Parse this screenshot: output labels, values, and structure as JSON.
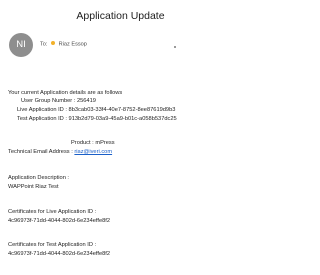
{
  "email": {
    "subject": "Application Update",
    "sender_initials": "NI",
    "to_label": "To:",
    "recipient": "Riaz Essop"
  },
  "body": {
    "intro": "Your current Application details are as follows",
    "user_group_line": "User Group Number : 256419",
    "live_app_id_line": "Live Application ID : 8b3cab03-33f4-40e7-8752-8ee87619d9b3",
    "test_app_id_line": "Test Application ID : 913b2d79-03a9-45a9-b01c-a058b537dc25",
    "product_line": "Product : mPress",
    "tech_email_label": "Technical Email Address : ",
    "tech_email": "riaz@iveri.com",
    "app_desc_label": "Application Description :",
    "app_desc_value": "WAPPoint Riaz Test",
    "cert_live_label": "Certificates for Live Application ID :",
    "cert_live_value": "4c96973f-71dd-4044-802d-6e234effe8f2",
    "cert_test_label": "Certificates for Test Application ID :",
    "cert_test_value": "4c96973f-71dd-4044-802d-6e234effe8f2"
  },
  "colors": {
    "link": "#1a5fc8",
    "avatar_bg": "#8e8e8e",
    "presence": "#f2b12a"
  },
  "icons": {
    "presence": "presence-status-icon"
  }
}
